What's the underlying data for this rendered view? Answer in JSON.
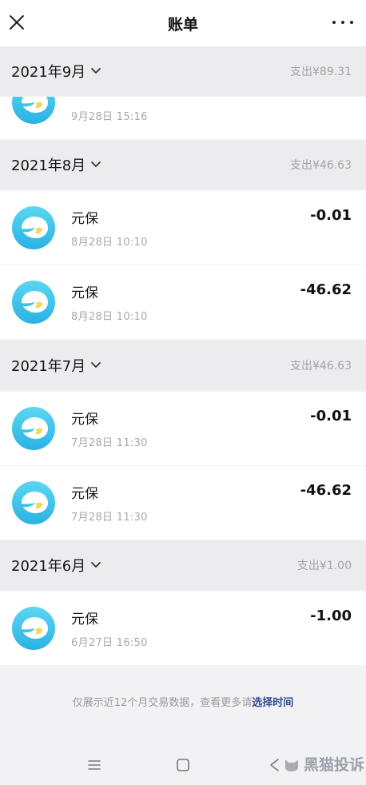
{
  "header": {
    "title": "账单"
  },
  "sections": [
    {
      "month": "2021年9月",
      "summary": "支出¥89.31",
      "partial_item": {
        "time": "9月28日 15:16"
      }
    },
    {
      "month": "2021年8月",
      "summary": "支出¥46.63",
      "items": [
        {
          "name": "元保",
          "time": "8月28日 10:10",
          "amount": "-0.01"
        },
        {
          "name": "元保",
          "time": "8月28日 10:10",
          "amount": "-46.62"
        }
      ]
    },
    {
      "month": "2021年7月",
      "summary": "支出¥46.63",
      "items": [
        {
          "name": "元保",
          "time": "7月28日 11:30",
          "amount": "-0.01"
        },
        {
          "name": "元保",
          "time": "7月28日 11:30",
          "amount": "-46.62"
        }
      ]
    },
    {
      "month": "2021年6月",
      "summary": "支出¥1.00",
      "items": [
        {
          "name": "元保",
          "time": "6月27日 16:50",
          "amount": "-1.00"
        }
      ]
    }
  ],
  "footer": {
    "note": "仅展示近12个月交易数据，查看更多请",
    "link": "选择时间"
  },
  "watermark": "黑猫投诉",
  "icons": {
    "close": "close-icon",
    "more": "more-icon",
    "chevron": "chevron-down-icon",
    "merchant_logo": "yuanbao-logo-icon",
    "nav_menu": "menu-icon",
    "nav_home": "home-icon",
    "nav_back": "back-icon"
  },
  "colors": {
    "logo_gradient_top": "#4fd0f0",
    "logo_gradient_bottom": "#2bb6e4",
    "link": "#2f4f8f"
  }
}
